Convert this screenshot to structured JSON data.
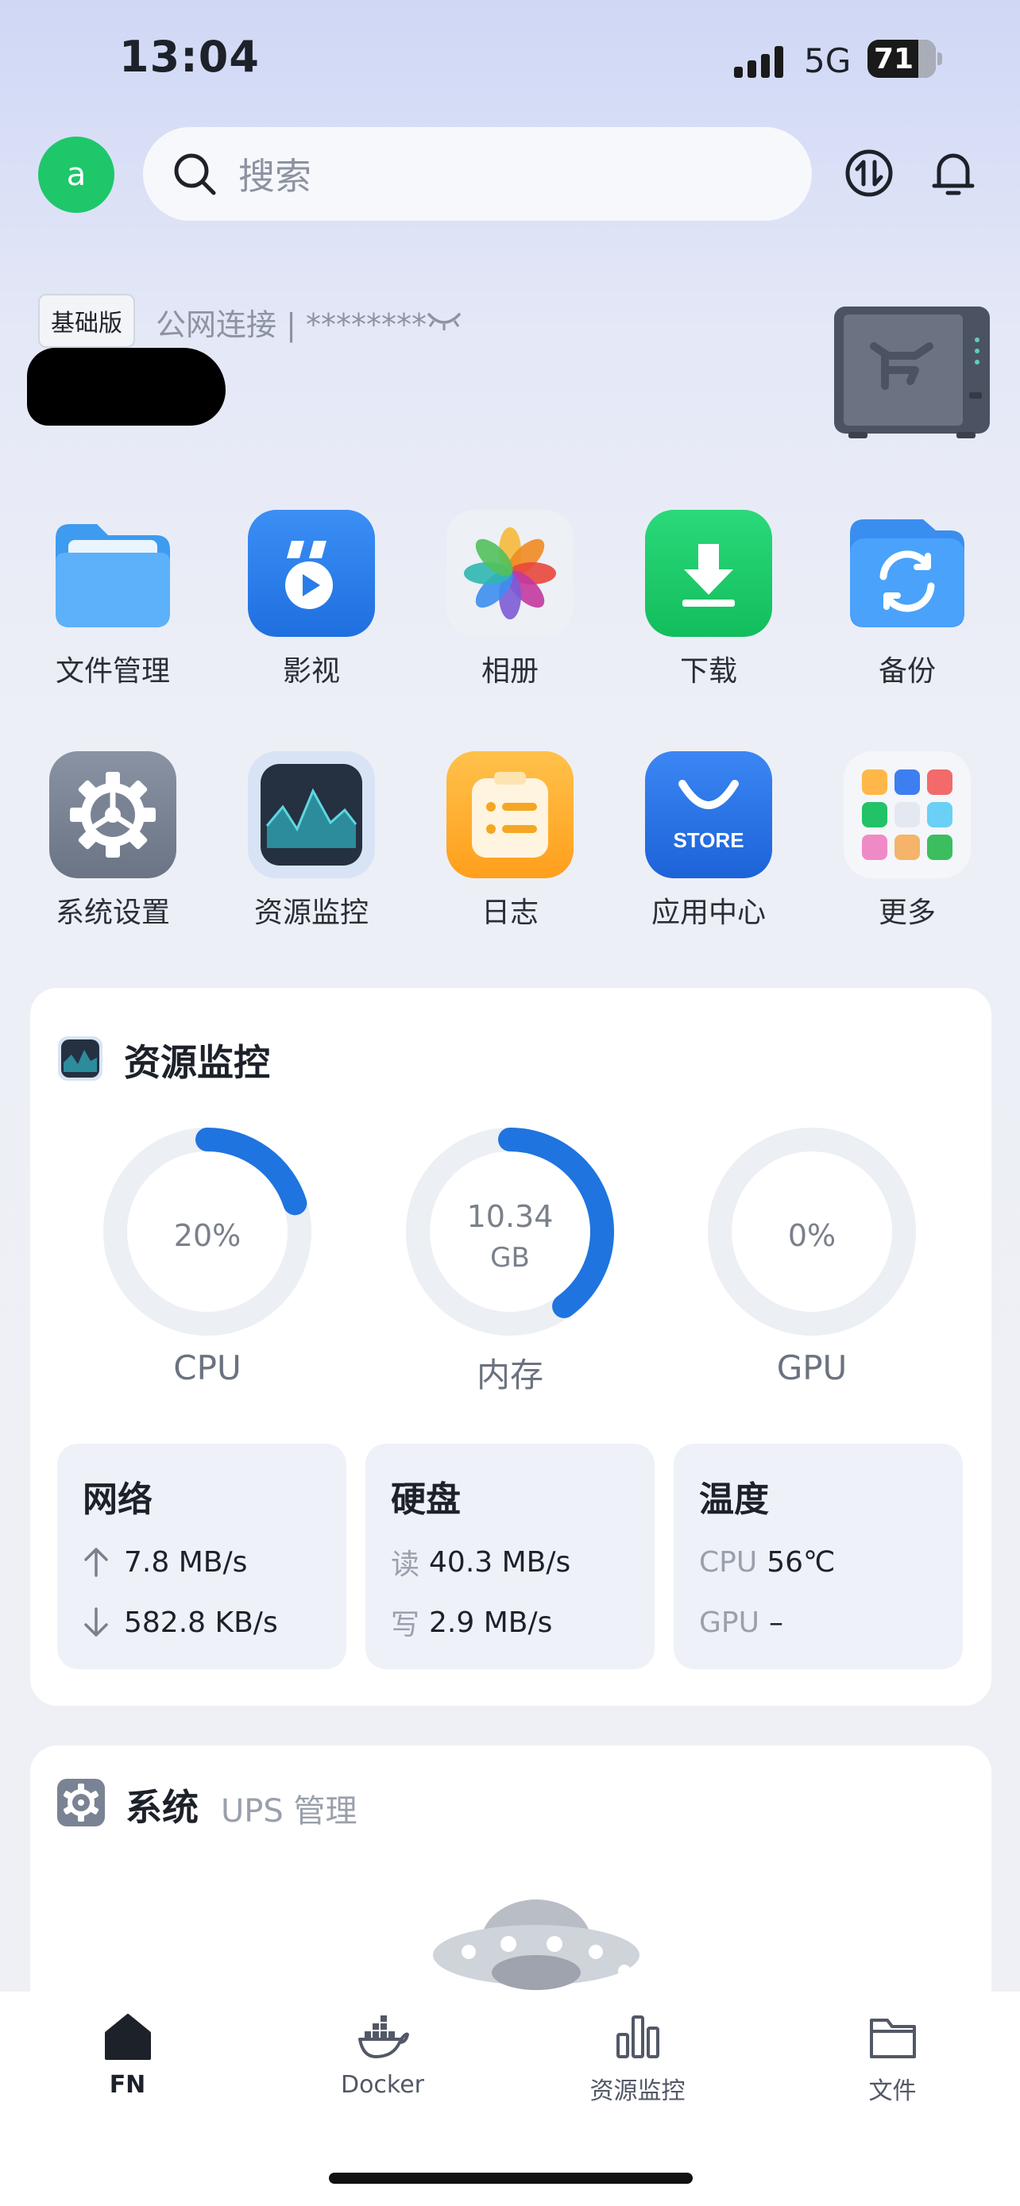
{
  "status_bar": {
    "time": "13:04",
    "network": "5G",
    "battery": "71"
  },
  "header": {
    "avatar_letter": "a",
    "search_placeholder": "搜索"
  },
  "device": {
    "edition": "基础版",
    "connection": "公网连接 | ********"
  },
  "apps": [
    {
      "label": "文件管理",
      "icon": "folder-icon"
    },
    {
      "label": "影视",
      "icon": "video-icon"
    },
    {
      "label": "相册",
      "icon": "photos-icon"
    },
    {
      "label": "下载",
      "icon": "download-icon"
    },
    {
      "label": "备份",
      "icon": "backup-icon"
    },
    {
      "label": "系统设置",
      "icon": "settings-icon"
    },
    {
      "label": "资源监控",
      "icon": "monitor-icon"
    },
    {
      "label": "日志",
      "icon": "log-icon"
    },
    {
      "label": "应用中心",
      "icon": "store-icon"
    },
    {
      "label": "更多",
      "icon": "more-icon"
    }
  ],
  "store_badge": "STORE",
  "monitor": {
    "title": "资源监控",
    "cpu": {
      "value": "20%",
      "label": "CPU",
      "fraction": 0.2
    },
    "memory": {
      "value": "10.34",
      "unit": "GB",
      "label": "内存",
      "fraction": 0.4
    },
    "gpu": {
      "value": "0%",
      "label": "GPU",
      "fraction": 0
    },
    "network": {
      "title": "网络",
      "up": "7.8 MB/s",
      "down": "582.8 KB/s"
    },
    "disk": {
      "title": "硬盘",
      "read_key": "读",
      "read": "40.3 MB/s",
      "write_key": "写",
      "write": "2.9 MB/s"
    },
    "temp": {
      "title": "温度",
      "cpu_key": "CPU",
      "cpu": "56℃",
      "gpu_key": "GPU",
      "gpu": "–"
    }
  },
  "system_card": {
    "title": "系统",
    "subtitle": "UPS 管理"
  },
  "tabs": [
    {
      "label": "FN",
      "icon": "home-icon",
      "active": true
    },
    {
      "label": "Docker",
      "icon": "docker-icon",
      "active": false
    },
    {
      "label": "资源监控",
      "icon": "bar-chart-icon",
      "active": false
    },
    {
      "label": "文件",
      "icon": "folder-outline-icon",
      "active": false
    }
  ],
  "colors": {
    "accent": "#1f74e0",
    "avatar": "#1ec76a",
    "ring_track": "#eceff3"
  }
}
